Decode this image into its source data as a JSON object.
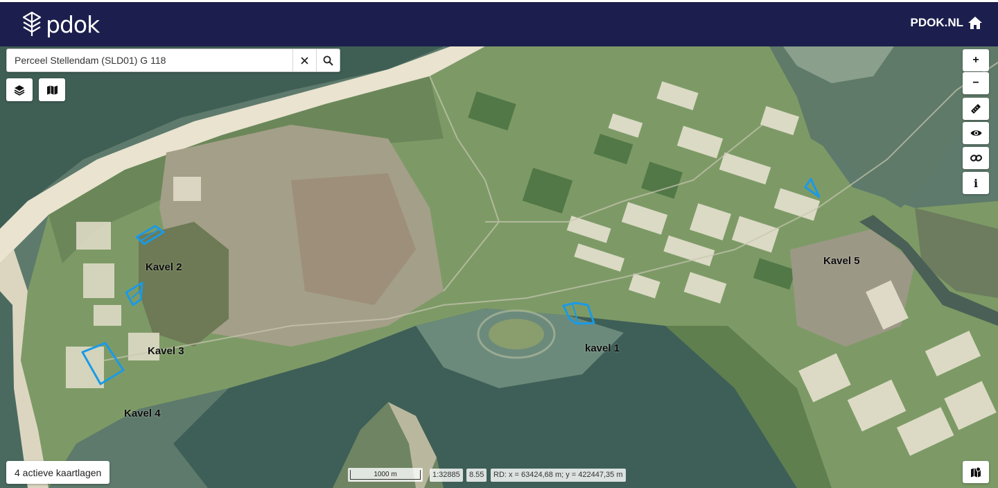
{
  "header": {
    "brand": "pdok",
    "home_label": "PDOK.NL",
    "logo_icon": "pdok-layers-logo",
    "home_icon": "home-icon",
    "background": "#1c1f4d"
  },
  "search": {
    "value": "Perceel Stellendam (SLD01) G 118",
    "clear_icon": "close-icon",
    "search_icon": "search-icon"
  },
  "toolbar_left": {
    "layers_icon": "layers-icon",
    "basemap_icon": "map-icon"
  },
  "toolbar_right": {
    "zoom_in": "+",
    "zoom_out": "−",
    "info": "i",
    "measure_icon": "ruler-icon",
    "visibility_icon": "eye-icon",
    "share_icon": "link-icon",
    "legend_icon": "map-legend-icon"
  },
  "map_labels": {
    "kavel1": "kavel 1",
    "kavel2": "Kavel 2",
    "kavel3": "Kavel 3",
    "kavel4": "Kavel 4",
    "kavel5": "Kavel 5"
  },
  "parcel_color": "#1a9ae6",
  "footer": {
    "active_layers": "4 actieve kaartlagen",
    "scale_bar_label": "1000 m",
    "scale": "1:32885",
    "zoom_level": "8.55",
    "coordinates": "RD: x = 63424,68 m; y = 422447,35 m"
  }
}
